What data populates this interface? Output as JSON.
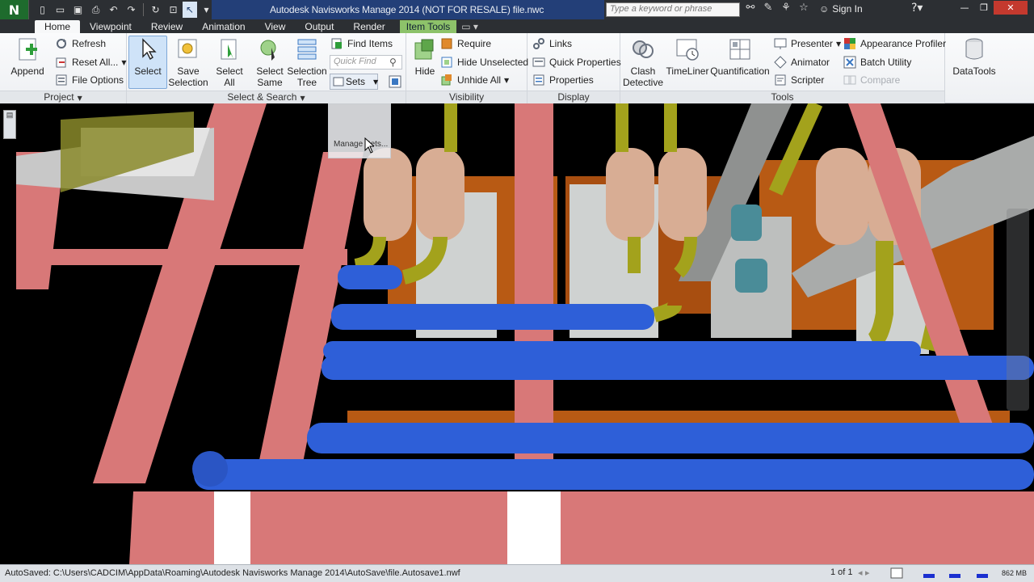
{
  "window": {
    "title": "Autodesk Navisworks Manage 2014 (NOT FOR RESALE)   file.nwc",
    "search_placeholder": "Type a keyword or phrase",
    "sign_in": "Sign In",
    "logo_letter": "N"
  },
  "tabs": [
    "Home",
    "Viewpoint",
    "Review",
    "Animation",
    "View",
    "Output",
    "Render",
    "Item Tools"
  ],
  "ribbon": {
    "project": {
      "title": "Project",
      "append": "Append",
      "refresh": "Refresh",
      "reset_all": "Reset All...",
      "file_options": "File Options"
    },
    "select_search": {
      "title": "Select & Search",
      "select": "Select",
      "save_selection_1": "Save",
      "save_selection_2": "Selection",
      "select_all_1": "Select",
      "select_all_2": "All",
      "select_same_1": "Select",
      "select_same_2": "Same",
      "selection_tree_1": "Selection",
      "selection_tree_2": "Tree",
      "find_items": "Find Items",
      "quick_find_placeholder": "Quick Find",
      "sets": "Sets"
    },
    "visibility": {
      "title": "Visibility",
      "hide": "Hide",
      "require": "Require",
      "hide_unselected": "Hide Unselected",
      "unhide_all": "Unhide All"
    },
    "display": {
      "title": "Display",
      "links": "Links",
      "quick_properties": "Quick Properties",
      "properties": "Properties"
    },
    "tools": {
      "title": "Tools",
      "clash_1": "Clash",
      "clash_2": "Detective",
      "timeliner": "TimeLiner",
      "quantification": "Quantification",
      "presenter": "Presenter",
      "animator": "Animator",
      "scripter": "Scripter",
      "appearance_profiler": "Appearance Profiler",
      "batch_utility": "Batch Utility",
      "compare": "Compare",
      "datatools": "DataTools"
    }
  },
  "dropdown": {
    "manage_sets": "Manage Sets..."
  },
  "status": {
    "path": "AutoSaved: C:\\Users\\CADCIM\\AppData\\Roaming\\Autodesk Navisworks Manage 2014\\AutoSave\\file.Autosave1.nwf",
    "pages": "1 of 1",
    "memory": "862 MB"
  },
  "colors": {
    "pipe_blue": "#2e5fd8",
    "beam_pink": "#d87878",
    "tank_tan": "#d8ad94",
    "pipe_olive": "#a3a21c",
    "floor_orange": "#b85a14",
    "context_tab": "#8dc26a"
  }
}
